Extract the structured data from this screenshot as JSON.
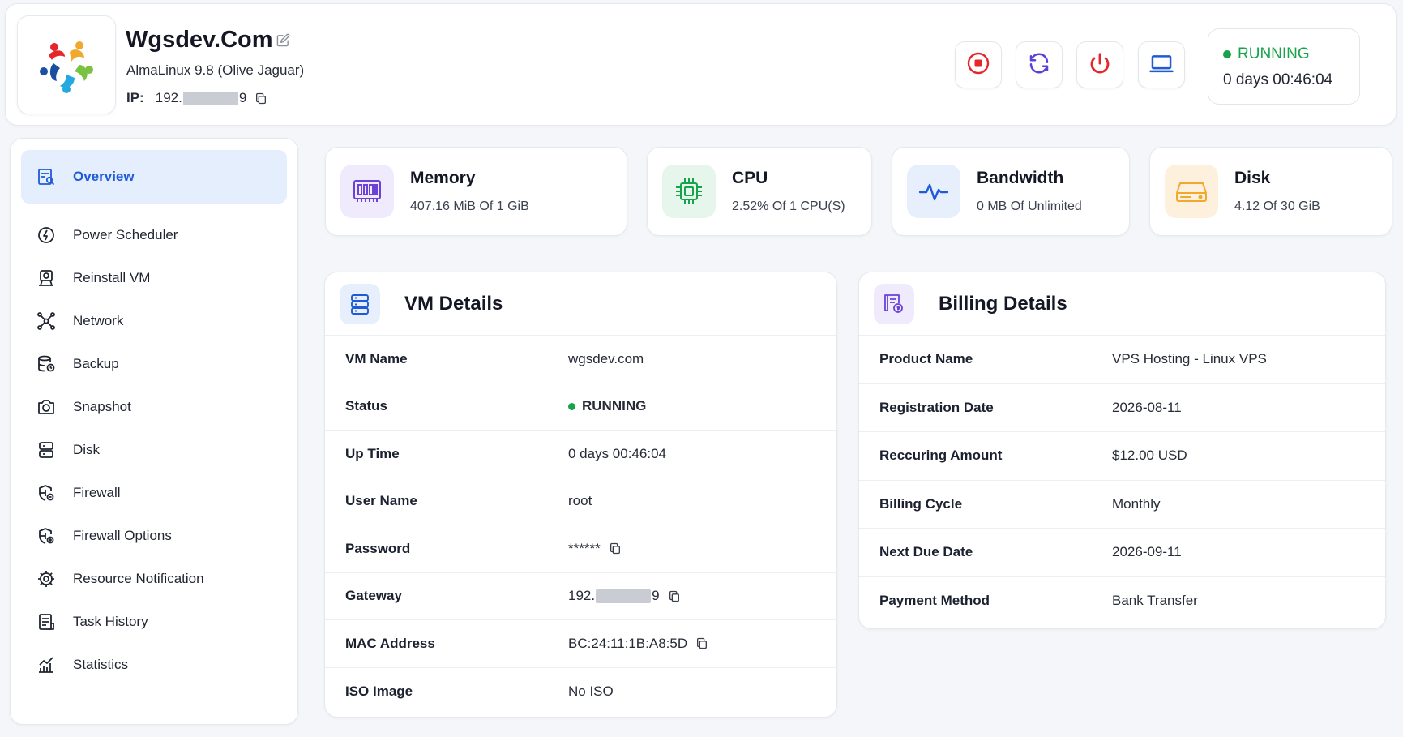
{
  "header": {
    "vm_title": "Wgsdev.Com",
    "os": "AlmaLinux 9.8 (Olive Jaguar)",
    "ip_label": "IP:",
    "ip_prefix": "192.",
    "ip_suffix": "9",
    "actions": [
      "stop-icon",
      "restart-icon",
      "power-icon",
      "console-icon"
    ],
    "status": "RUNNING",
    "uptime": "0 days 00:46:04"
  },
  "sidebar": {
    "items": [
      {
        "label": "Overview",
        "icon": "overview-icon",
        "active": true
      },
      {
        "label": "Power Scheduler",
        "icon": "power-scheduler-icon"
      },
      {
        "label": "Reinstall VM",
        "icon": "reinstall-icon"
      },
      {
        "label": "Network",
        "icon": "network-icon"
      },
      {
        "label": "Backup",
        "icon": "backup-icon"
      },
      {
        "label": "Snapshot",
        "icon": "snapshot-icon"
      },
      {
        "label": "Disk",
        "icon": "disk-icon"
      },
      {
        "label": "Firewall",
        "icon": "firewall-icon"
      },
      {
        "label": "Firewall Options",
        "icon": "firewall-options-icon"
      },
      {
        "label": "Resource Notification",
        "icon": "resource-notification-icon"
      },
      {
        "label": "Task History",
        "icon": "task-history-icon"
      },
      {
        "label": "Statistics",
        "icon": "statistics-icon"
      }
    ]
  },
  "stats": {
    "memory": {
      "title": "Memory",
      "value": "407.16 MiB Of 1 GiB"
    },
    "cpu": {
      "title": "CPU",
      "value": "2.52% Of 1 CPU(S)"
    },
    "bandwidth": {
      "title": "Bandwidth",
      "value": "0 MB Of Unlimited"
    },
    "disk": {
      "title": "Disk",
      "value": "4.12 Of 30 GiB"
    }
  },
  "vm_details": {
    "title": "VM Details",
    "rows": {
      "vm_name": {
        "label": "VM Name",
        "value": "wgsdev.com"
      },
      "status": {
        "label": "Status",
        "value": "RUNNING"
      },
      "uptime": {
        "label": "Up Time",
        "value": "0 days 00:46:04"
      },
      "username": {
        "label": "User Name",
        "value": "root"
      },
      "password": {
        "label": "Password",
        "value": "******"
      },
      "gateway": {
        "label": "Gateway",
        "prefix": "192.",
        "suffix": "9"
      },
      "mac": {
        "label": "MAC Address",
        "value": "BC:24:11:1B:A8:5D"
      },
      "iso": {
        "label": "ISO Image",
        "value": "No ISO"
      }
    }
  },
  "billing_details": {
    "title": "Billing Details",
    "rows": {
      "product": {
        "label": "Product Name",
        "value": "VPS Hosting - Linux VPS"
      },
      "registration": {
        "label": "Registration Date",
        "value": "2026-08-11"
      },
      "amount": {
        "label": "Reccuring Amount",
        "value": "$12.00 USD"
      },
      "cycle": {
        "label": "Billing Cycle",
        "value": "Monthly"
      },
      "due": {
        "label": "Next Due Date",
        "value": "2026-09-11"
      },
      "payment": {
        "label": "Payment Method",
        "value": "Bank Transfer"
      }
    }
  },
  "colors": {
    "accent": "#1f5bd8",
    "running": "#17a34a",
    "stop": "#e5262b",
    "restart": "#5b3fd8",
    "disk": "#f0a92e"
  }
}
